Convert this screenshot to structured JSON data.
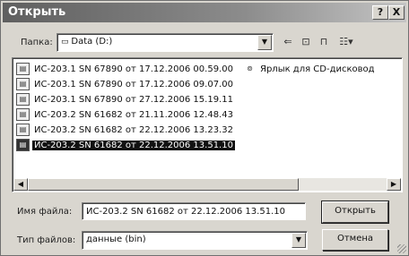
{
  "dialog": {
    "title": "Открыть",
    "help_button": "?",
    "close_button": "X"
  },
  "folder": {
    "label": "Папка:",
    "value": "Data (D:)",
    "drive_icon": "drive-icon"
  },
  "toolbar": {
    "back": "⇐",
    "up": "⊡",
    "new_folder": "⊓",
    "view": "☷▾"
  },
  "files": [
    {
      "name": "ИС-203.1 SN 67890 от 17.12.2006 00.59.00",
      "selected": false
    },
    {
      "name": "ИС-203.1 SN 67890 от 17.12.2006 09.07.00",
      "selected": false
    },
    {
      "name": "ИС-203.1 SN 67890 от 27.12.2006 15.19.11",
      "selected": false
    },
    {
      "name": "ИС-203.2 SN 61682 от 21.11.2006 12.48.43",
      "selected": false
    },
    {
      "name": "ИС-203.2 SN 61682 от 22.12.2006 13.23.32",
      "selected": false
    },
    {
      "name": "ИС-203.2 SN 61682 от 22.12.2006 13.51.10",
      "selected": true
    }
  ],
  "shortcut": {
    "name": "Ярлык для CD-дисковод"
  },
  "filename": {
    "label": "Имя файла:",
    "value": "ИС-203.2 SN 61682 от 22.12.2006 13.51.10"
  },
  "filetype": {
    "label": "Тип файлов:",
    "value": "данные (bin)"
  },
  "buttons": {
    "open": "Открыть",
    "cancel": "Отмена"
  }
}
